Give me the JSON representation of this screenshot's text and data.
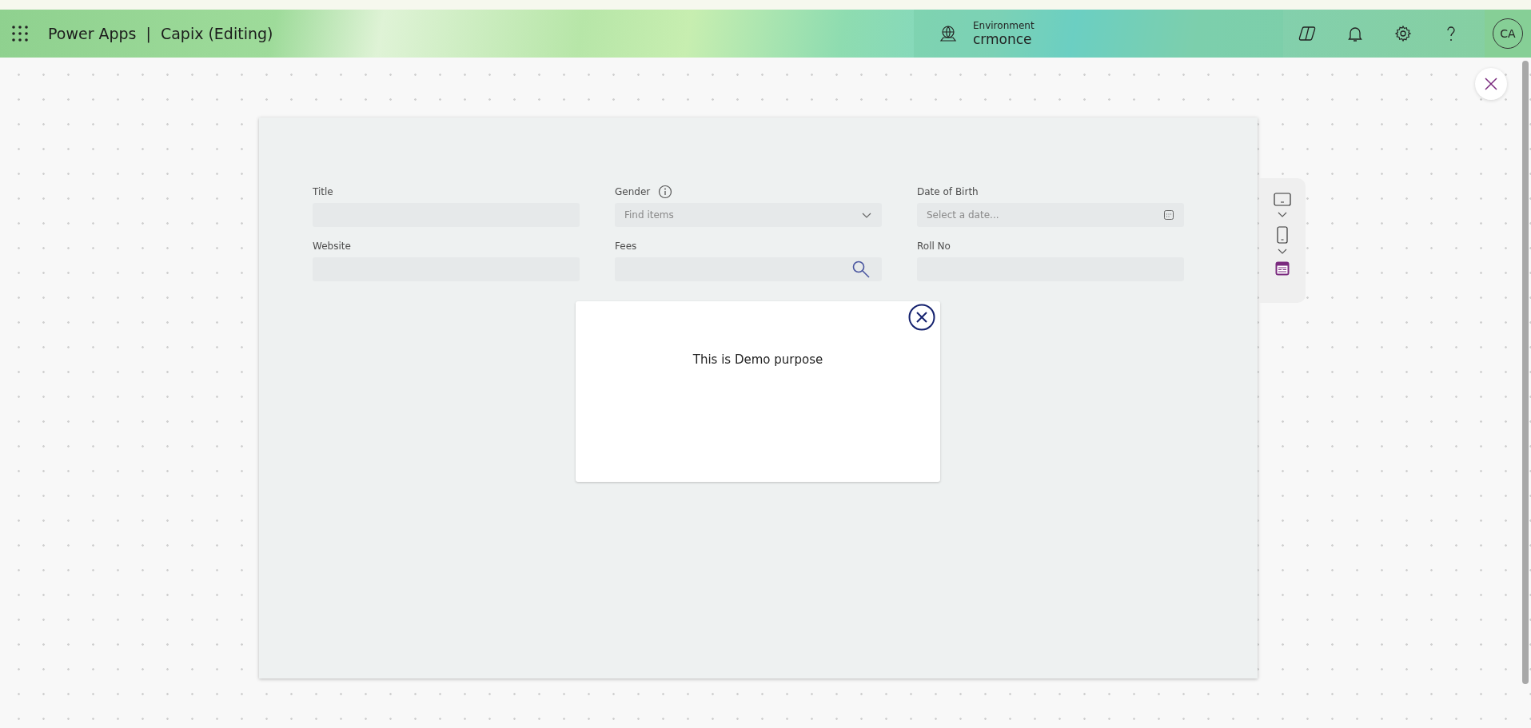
{
  "header": {
    "app_name": "Power Apps",
    "separator": "|",
    "app_title": "Capix (Editing)",
    "environment": {
      "label": "Environment",
      "value": "crmonce"
    },
    "avatar": "CA"
  },
  "form": {
    "fields": [
      {
        "label": "Title",
        "kind": "text",
        "info": false
      },
      {
        "label": "Gender",
        "kind": "dropdown",
        "info": true,
        "placeholder": "Find items"
      },
      {
        "label": "Date of Birth",
        "kind": "date",
        "info": false,
        "placeholder": "Select a date..."
      },
      {
        "label": "Website",
        "kind": "text",
        "info": false
      },
      {
        "label": "Fees",
        "kind": "search",
        "info": false
      },
      {
        "label": "Roll No",
        "kind": "text",
        "info": false
      }
    ]
  },
  "dialog": {
    "message": "This is Demo purpose"
  }
}
